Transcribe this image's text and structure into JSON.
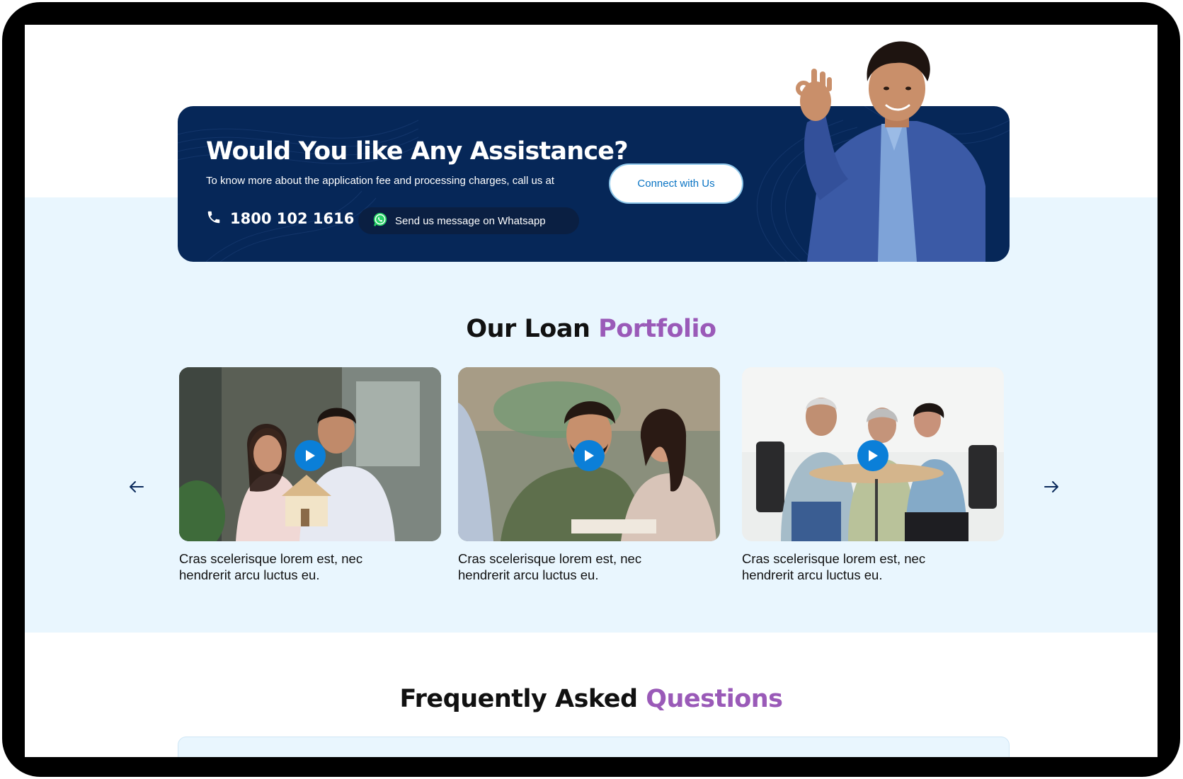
{
  "assist": {
    "title": "Would You like Any Assistance?",
    "subtitle": "To know more about the application fee and processing charges, call us at",
    "phone": "1800 102 1616",
    "whatsapp_label": "Send us message on Whatsapp",
    "connect_label": "Connect with Us"
  },
  "portfolio": {
    "title_main": "Our Loan",
    "title_accent": "Portfolio",
    "cards": [
      {
        "caption": "Cras scelerisque lorem est, nec hendrerit arcu luctus eu."
      },
      {
        "caption": "Cras scelerisque lorem est, nec hendrerit arcu luctus eu."
      },
      {
        "caption": "Cras scelerisque lorem est, nec hendrerit arcu luctus eu."
      }
    ]
  },
  "faq": {
    "title_main": "Frequently Asked",
    "title_accent": "Questions"
  },
  "icons": {
    "phone": "phone-icon",
    "whatsapp": "whatsapp-icon",
    "play": "play-icon",
    "prev": "arrow-left-icon",
    "next": "arrow-right-icon"
  },
  "colors": {
    "banner_bg": "#062758",
    "accent_purple": "#9a5ab8",
    "play_blue": "#0b7fd8",
    "section_bg": "#e9f6fe"
  }
}
